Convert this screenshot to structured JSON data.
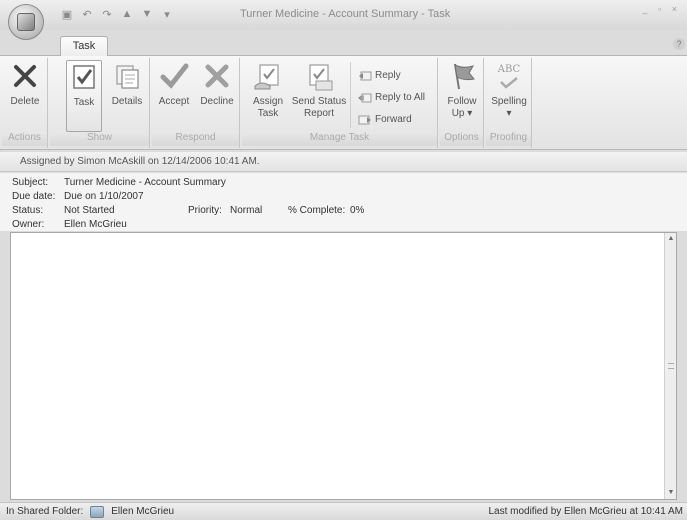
{
  "window": {
    "title": "Turner Medicine - Account Summary - Task",
    "controls": "_ ▫ ×"
  },
  "quick_access": [
    "save-icon",
    "undo-icon",
    "redo-icon",
    "up-arrow-icon",
    "down-arrow-icon",
    "customize-icon"
  ],
  "tabs": [
    {
      "label": "Task"
    }
  ],
  "ribbon": {
    "groups": {
      "actions": "Actions",
      "show": "Show",
      "respond": "Respond",
      "manage_task": "Manage Task",
      "options": "Options",
      "proofing": "Proofing"
    },
    "buttons": {
      "delete": "Delete",
      "task": "Task",
      "details": "Details",
      "accept": "Accept",
      "decline": "Decline",
      "assign_task_1": "Assign",
      "assign_task_2": "Task",
      "send_status_1": "Send Status",
      "send_status_2": "Report",
      "reply": "Reply",
      "reply_all": "Reply to All",
      "forward": "Forward",
      "follow_up_1": "Follow",
      "follow_up_2": "Up ▾",
      "spelling": "Spelling",
      "spelling_arrow": "▾",
      "abc": "ABC"
    }
  },
  "infobar": {
    "text": "Assigned by Simon McAskill on 12/14/2006 10:41 AM."
  },
  "fields": {
    "subject_label": "Subject:",
    "subject_value": "Turner Medicine - Account Summary",
    "due_label": "Due date:",
    "due_value": "Due on 1/10/2007",
    "status_label": "Status:",
    "status_value": "Not Started",
    "priority_label": "Priority:",
    "priority_value": "Normal",
    "complete_label": "% Complete:",
    "complete_value": "0%",
    "owner_label": "Owner:",
    "owner_value": "Ellen McGrieu"
  },
  "statusbar": {
    "folder_label": "In Shared Folder:",
    "folder_owner": "Ellen McGrieu",
    "modified": "Last modified by Ellen McGrieu at 10:41 AM"
  },
  "colors": {
    "ribbon_bg": "#efefef",
    "title_text": "#8c8c8c",
    "label_grey": "#aaaaaa"
  }
}
